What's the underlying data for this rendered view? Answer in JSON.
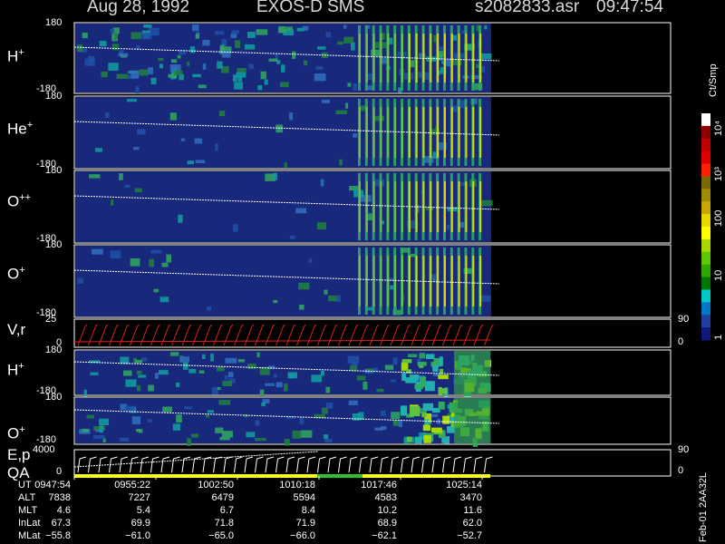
{
  "header": {
    "date": "Aug 28, 1992",
    "mission": "EXOS-D SMS",
    "file": "s2082833.asr",
    "time": "09:47:54"
  },
  "panels": [
    {
      "label": "H",
      "sup": "+",
      "ymax": "180",
      "ymin": "-180"
    },
    {
      "label": "He",
      "sup": "+",
      "ymax": "180",
      "ymin": "-180"
    },
    {
      "label": "O",
      "sup": "++",
      "ymax": "180",
      "ymin": "-180"
    },
    {
      "label": "O",
      "sup": "+",
      "ymax": "180",
      "ymin": "-180"
    },
    {
      "label": "V,r",
      "sup": "",
      "ymax": "25",
      "ymin": "0",
      "rmax": "90",
      "rmin": "0"
    },
    {
      "label": "H",
      "sup": "+",
      "ymax": "180",
      "ymin": "-180"
    },
    {
      "label": "O",
      "sup": "+",
      "ymax": "180",
      "ymin": "-180"
    },
    {
      "label": "E,p",
      "sup": "",
      "label2": "QA",
      "ymax": "4000",
      "ymin": "0",
      "rmax": "90",
      "rmin": "0"
    }
  ],
  "colorbar": {
    "title": "Ct/Smp",
    "labels": [
      "10⁴",
      "10³",
      "100",
      "10",
      "1"
    ],
    "colors": [
      "#ffffff",
      "#900000",
      "#c00000",
      "#e00000",
      "#ff2000",
      "#7a6a00",
      "#a08a00",
      "#c8a800",
      "#e8d800",
      "#ffff00",
      "#a8d800",
      "#60c800",
      "#30a800",
      "#007800",
      "#00c8c8",
      "#0078c8",
      "#2040a0",
      "#101878"
    ]
  },
  "table": {
    "labels": [
      "UT",
      "ALT",
      "MLT",
      "InLat",
      "MLat"
    ],
    "columns": [
      [
        "0947:54",
        "7838",
        "4.6",
        "67.3",
        "−55.8"
      ],
      [
        "0955:22",
        "7227",
        "5.4",
        "69.9",
        "−61.0"
      ],
      [
        "1002:50",
        "6479",
        "6.7",
        "71.8",
        "−65.0"
      ],
      [
        "1010:18",
        "5594",
        "8.4",
        "71.9",
        "−66.0"
      ],
      [
        "1017:46",
        "4583",
        "10.2",
        "68.9",
        "−62.1"
      ],
      [
        "1025:14",
        "3470",
        "11.6",
        "62.0",
        "−52.7"
      ]
    ]
  },
  "footer": "Feb-01 2AA32L",
  "colors": {
    "background": "#000000",
    "panel_fill": "#18287a",
    "trace": "#ffffff",
    "vr_trace": "#e02020",
    "qa_yellow": "#ffff00",
    "qa_green": "#30c030"
  },
  "chart_data": {
    "type": "heatmap",
    "title": "Aug 28, 1992   EXOS-D SMS",
    "x_ticks": [
      "0947:54",
      "0955:22",
      "1002:50",
      "1010:18",
      "1017:46",
      "1025:14"
    ],
    "ylim": [
      -180,
      180
    ],
    "color_scale": "log",
    "color_range": [
      1,
      10000
    ],
    "data_end_fraction": 0.9
  }
}
